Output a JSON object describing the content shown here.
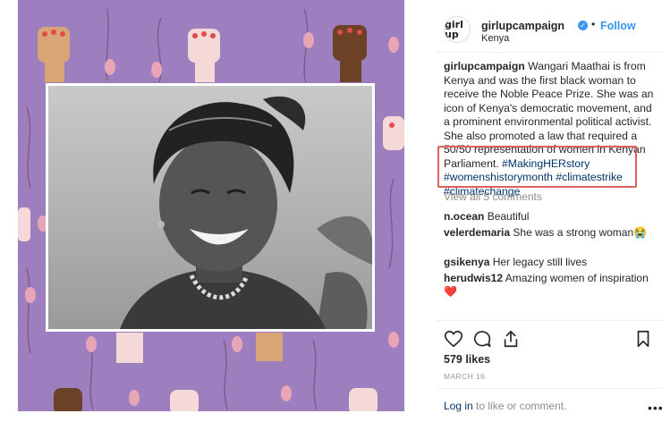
{
  "post": {
    "account": {
      "username": "girlupcampaign",
      "avatar_text": "girl up",
      "verified_icon": "check-icon",
      "dot": "•",
      "follow_label": "Follow",
      "location": "Kenya"
    },
    "caption": {
      "username": "girlupcampaign",
      "text": "Wangari Maathai is from Kenya and was the first black woman to receive the Noble Peace Prize. She was an icon of Kenya's democratic movement, and a prominent environmental political activist. She also promoted a law that required a 50/50 representation of women in Kenyan Parliament.",
      "hashtags": [
        "#MakingHERstory",
        "#womenshistorymonth",
        "#climatestrike",
        "#climatechange"
      ]
    },
    "view_all_comments": "View all 5 comments",
    "comments": [
      {
        "username": "n.ocean",
        "text": "Beautiful",
        "emoji": ""
      },
      {
        "username": "velerdemaria",
        "text": "She was a strong woman",
        "emoji": "😭"
      },
      {
        "username": "gsikenya",
        "text": "Her legacy still lives",
        "emoji": ""
      },
      {
        "username": "herudwis12",
        "text": "Amazing women of inspiration",
        "emoji": "❤️"
      }
    ],
    "actions": {
      "like_icon": "heart-icon",
      "comment_icon": "comment-bubble-icon",
      "share_icon": "share-icon",
      "save_icon": "bookmark-icon"
    },
    "likes": "579 likes",
    "date": "MARCH 16",
    "login": {
      "link": "Log in",
      "rest": "to like or comment."
    },
    "more_icon": "•••",
    "colors": {
      "image_background": "#9d7fc0",
      "link_blue": "#3897f0",
      "hashtag_blue": "#003569",
      "highlight_red": "#e0605e"
    }
  }
}
